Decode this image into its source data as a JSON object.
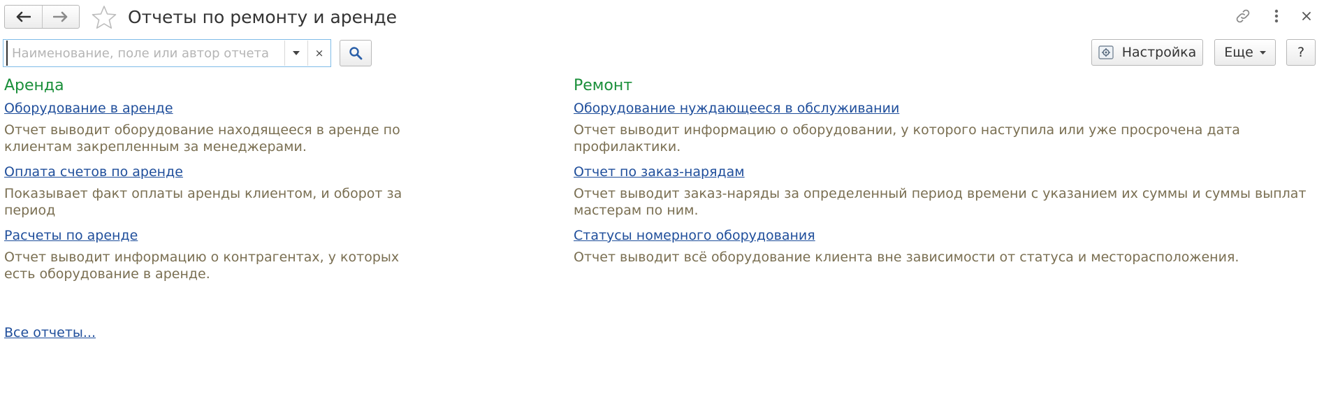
{
  "window": {
    "title": "Отчеты по ремонту и аренде",
    "back_icon": "arrow-left-icon",
    "forward_icon": "arrow-right-icon",
    "favorite_icon": "star-icon",
    "link_icon": "link-icon",
    "menu_icon": "more-vertical-icon",
    "close_icon": "close-icon"
  },
  "search": {
    "placeholder": "Наименование, поле или автор отчета",
    "value": "",
    "dropdown_icon": "chevron-down-icon",
    "clear_label": "×",
    "button_icon": "search-icon"
  },
  "toolbar": {
    "settings_label": "Настройка",
    "settings_icon": "settings-icon",
    "more_label": "Еще",
    "help_label": "?"
  },
  "groups": [
    {
      "title": "Аренда",
      "reports": [
        {
          "name": "Оборудование в аренде",
          "description": "Отчет выводит оборудование находящееся в аренде по клиентам закрепленным за менеджерами."
        },
        {
          "name": "Оплата счетов по аренде",
          "description": "Показывает факт оплаты аренды клиентом, и оборот за период"
        },
        {
          "name": "Расчеты по аренде",
          "description": "Отчет выводит информацию о контрагентах, у которых есть оборудование в аренде."
        }
      ]
    },
    {
      "title": "Ремонт",
      "reports": [
        {
          "name": "Оборудование нуждающееся в обслуживании",
          "description": "Отчет выводит информацию о оборудовании, у которого наступила или уже просрочена дата профилактики."
        },
        {
          "name": "Отчет по заказ-нарядам",
          "description": "Отчет выводит заказ-наряды за определенный период времени с указанием их суммы и суммы выплат мастерам по ним."
        },
        {
          "name": "Статусы номерного оборудования",
          "description": "Отчет выводит всё оборудование клиента вне зависимости от статуса и месторасположения."
        }
      ]
    }
  ],
  "all_reports_label": "Все отчеты...",
  "colors": {
    "group_title": "#1a8f3a",
    "link": "#1f4e9b",
    "description": "#7a6f52",
    "search_border": "#7fbce8"
  }
}
